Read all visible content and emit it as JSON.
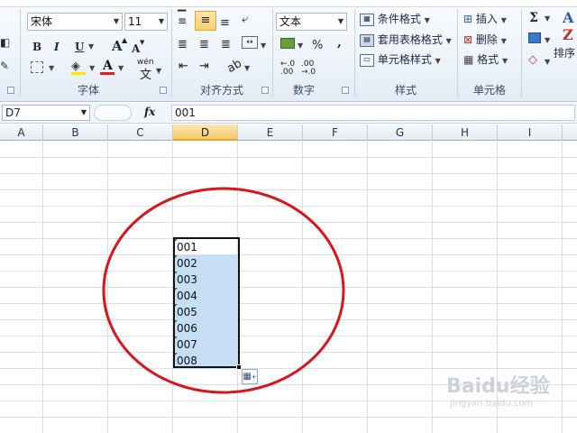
{
  "ribbon": {
    "font": {
      "family_value": "宋体",
      "size_value": "11",
      "bold": "B",
      "italic": "I",
      "underline": "U",
      "grow_font": "A",
      "shrink_font": "A",
      "font_color_letter": "A",
      "phonetic": "wén",
      "group_label": "字体"
    },
    "alignment": {
      "group_label": "对齐方式"
    },
    "number": {
      "format_value": "文本",
      "percent": "%",
      "comma": ",",
      "inc_decimal": "←.0 .00",
      "dec_decimal": ".00 →.0",
      "group_label": "数字"
    },
    "styles": {
      "conditional_format": "条件格式",
      "table_format": "套用表格格式",
      "cell_styles": "单元格样式",
      "group_label": "样式"
    },
    "cells": {
      "insert": "插入",
      "delete": "删除",
      "format": "格式",
      "group_label": "单元格"
    },
    "editing": {
      "sum": "Σ",
      "sort_label": "排序"
    },
    "accent_color": "#e3ebf6"
  },
  "formula_bar": {
    "name_box": "D7",
    "fx": "fx",
    "value": "001"
  },
  "columns": [
    "A",
    "B",
    "C",
    "D",
    "E",
    "F",
    "G",
    "H",
    "I"
  ],
  "selected_column": "D",
  "cells_d": [
    "001",
    "002",
    "003",
    "004",
    "005",
    "006",
    "007",
    "008"
  ],
  "watermark": {
    "brand": "Baidu经验",
    "url": "jingyan.baidu.com"
  },
  "colors": {
    "selection_fill": "#c6ddf6",
    "circle": "#d9141a",
    "header_selected": "#f4c96a"
  }
}
